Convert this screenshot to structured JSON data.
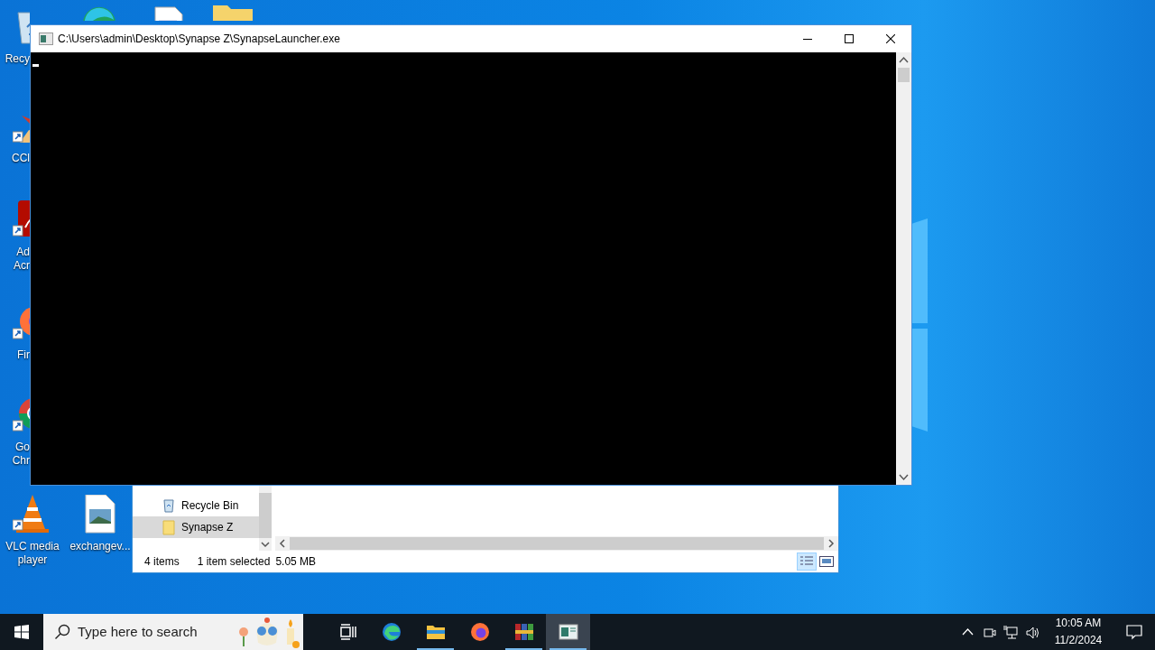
{
  "desktop_icons": [
    {
      "kind": "recycle",
      "label_lines": [
        "Recy"
      ]
    },
    {
      "kind": "browser"
    },
    {
      "kind": "document"
    },
    {
      "kind": "folder"
    },
    {
      "kind": "cleaner",
      "label_lines": [
        "CCl"
      ]
    },
    {
      "kind": "pdf",
      "label_lines": [
        "Ad",
        "Acr"
      ]
    },
    {
      "kind": "firefox",
      "label_lines": [
        "Fir"
      ]
    },
    {
      "kind": "chrome",
      "label_lines": [
        "Go",
        "Chr"
      ]
    },
    {
      "kind": "cone",
      "label_lines": [
        "VLC media",
        "player"
      ]
    },
    {
      "kind": "image",
      "label_lines": [
        "exchangev..."
      ]
    }
  ],
  "explorer": {
    "nav_items": [
      {
        "kind": "recycle",
        "label": "Recycle Bin",
        "selected": false
      },
      {
        "kind": "folder",
        "label": "Synapse Z",
        "selected": true
      }
    ],
    "status_bar": {
      "item_count": "4 items",
      "selection": "1 item selected",
      "size": "5.05 MB"
    }
  },
  "console": {
    "title": "C:\\Users\\admin\\Desktop\\Synapse Z\\SynapseLauncher.exe"
  },
  "taskbar": {
    "search": {
      "placeholder": "Type here to search"
    },
    "apps": [
      {
        "kind": "taskview",
        "running": false,
        "selected": false
      },
      {
        "kind": "edge",
        "running": false,
        "selected": false
      },
      {
        "kind": "explorer",
        "running": true,
        "selected": false
      },
      {
        "kind": "firefox",
        "running": false,
        "selected": false
      },
      {
        "kind": "archive",
        "running": true,
        "selected": false
      },
      {
        "kind": "console",
        "running": true,
        "selected": true
      }
    ],
    "time": "10:05 AM",
    "date": "11/2/2024"
  }
}
